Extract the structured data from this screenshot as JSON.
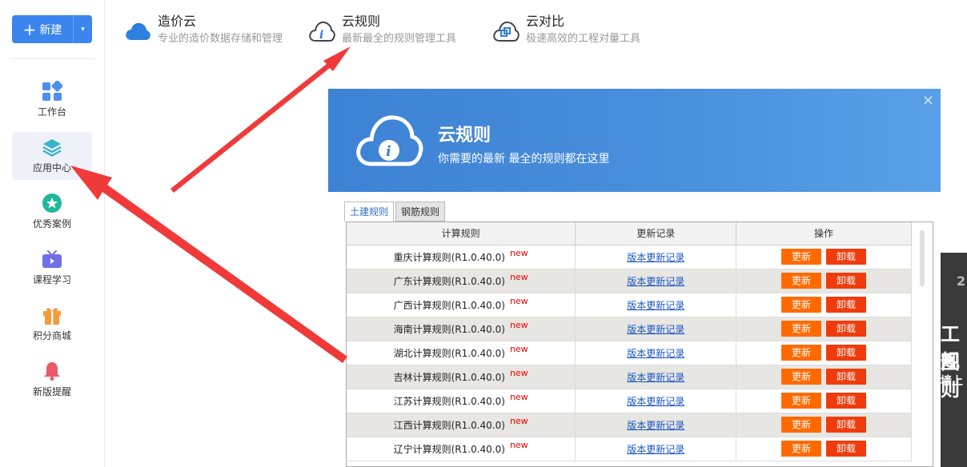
{
  "sidebar": {
    "new_button": {
      "label": "新建",
      "plus": "+",
      "caret": "▾"
    },
    "items": [
      {
        "label": "工作台",
        "icon": "grid-icon"
      },
      {
        "label": "应用中心",
        "icon": "layers-icon",
        "active": true
      },
      {
        "label": "优秀案例",
        "icon": "star-badge-icon"
      },
      {
        "label": "课程学习",
        "icon": "tv-icon"
      },
      {
        "label": "积分商城",
        "icon": "gift-icon"
      },
      {
        "label": "新版提醒",
        "icon": "bell-icon"
      }
    ]
  },
  "tools": [
    {
      "title": "造价云",
      "desc": "专业的造价数据存储和管理",
      "icon": "cloud-icon"
    },
    {
      "title": "云规则",
      "desc": "最新最全的规则管理工具",
      "icon": "info-cloud-icon"
    },
    {
      "title": "云对比",
      "desc": "极速高效的工程对量工具",
      "icon": "compare-cloud-icon"
    }
  ],
  "dialog": {
    "title": "云规则",
    "subtitle": "你需要的最新 最全的规则都在这里",
    "close": "×",
    "tabs": [
      {
        "label": "土建规则",
        "active": true
      },
      {
        "label": "钢筋规则",
        "active": false
      }
    ],
    "columns": [
      "计算规则",
      "更新记录",
      "操作"
    ],
    "rows": [
      {
        "name": "重庆计算规则(R1.0.40.0)",
        "tag": "new",
        "log": "版本更新记录",
        "update": "更新",
        "uninstall": "卸载"
      },
      {
        "name": "广东计算规则(R1.0.40.0)",
        "tag": "new",
        "log": "版本更新记录",
        "update": "更新",
        "uninstall": "卸载"
      },
      {
        "name": "广西计算规则(R1.0.40.0)",
        "tag": "new",
        "log": "版本更新记录",
        "update": "更新",
        "uninstall": "卸载"
      },
      {
        "name": "海南计算规则(R1.0.40.0)",
        "tag": "new",
        "log": "版本更新记录",
        "update": "更新",
        "uninstall": "卸载"
      },
      {
        "name": "湖北计算规则(R1.0.40.0)",
        "tag": "new",
        "log": "版本更新记录",
        "update": "更新",
        "uninstall": "卸载"
      },
      {
        "name": "吉林计算规则(R1.0.40.0)",
        "tag": "new",
        "log": "版本更新记录",
        "update": "更新",
        "uninstall": "卸载"
      },
      {
        "name": "江苏计算规则(R1.0.40.0)",
        "tag": "new",
        "log": "版本更新记录",
        "update": "更新",
        "uninstall": "卸载"
      },
      {
        "name": "江西计算规则(R1.0.40.0)",
        "tag": "new",
        "log": "版本更新记录",
        "update": "更新",
        "uninstall": "卸载"
      },
      {
        "name": "辽宁计算规则(R1.0.40.0)",
        "tag": "new",
        "log": "版本更新记录",
        "update": "更新",
        "uninstall": "卸载"
      }
    ]
  },
  "right_panel": {
    "texts": [
      "2",
      "工图",
      "规则",
      "墙上"
    ]
  },
  "colors": {
    "accent": "#3b86ee",
    "banner": "#4a90dd",
    "update": "#ff6a00",
    "uninstall": "#f23b0c",
    "arrow": "#f03a3a"
  }
}
